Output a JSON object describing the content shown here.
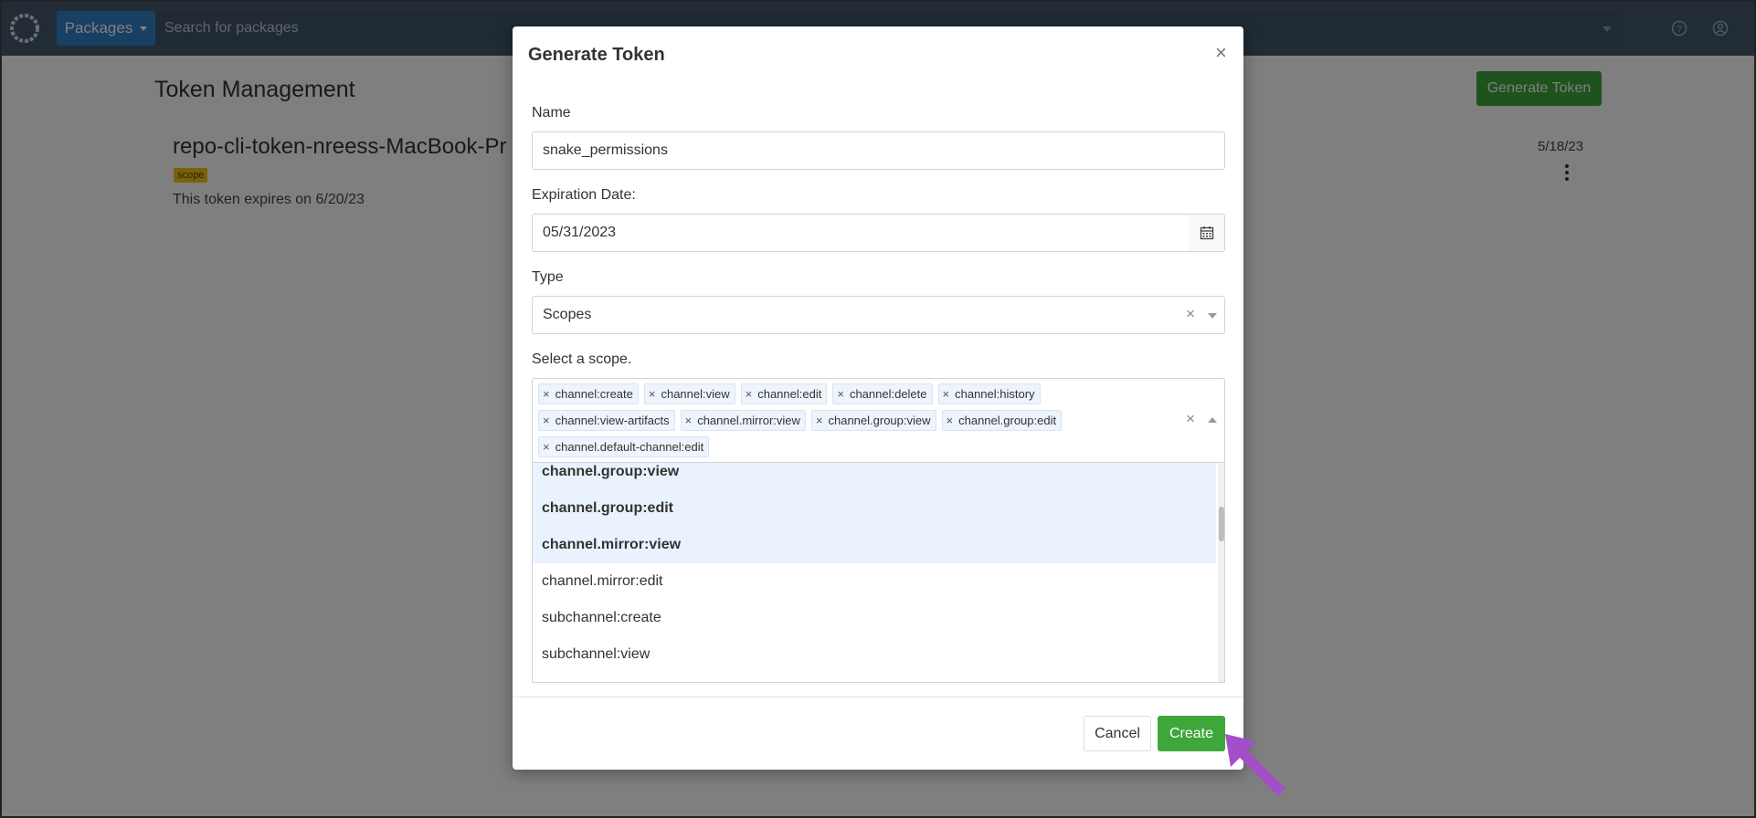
{
  "topbar": {
    "packages_label": "Packages",
    "search_placeholder": "Search for packages"
  },
  "page": {
    "title": "Token Management",
    "generate_button": "Generate Token",
    "token": {
      "name": "repo-cli-token-nreess-MacBook-Pr",
      "badge": "scope",
      "expiry": "This token expires on 6/20/23",
      "date": "5/18/23"
    }
  },
  "modal": {
    "title": "Generate Token",
    "name_label": "Name",
    "name_value": "snake_permissions",
    "expiration_label": "Expiration Date:",
    "expiration_value": "05/31/2023",
    "type_label": "Type",
    "type_value": "Scopes",
    "scope_label": "Select a scope.",
    "selected_scopes": [
      "channel:create",
      "channel:view",
      "channel:edit",
      "channel:delete",
      "channel:history",
      "channel:view-artifacts",
      "channel.mirror:view",
      "channel.group:view",
      "channel.group:edit",
      "channel.default-channel:edit"
    ],
    "options": [
      {
        "label": "channel.group:view",
        "selected": true
      },
      {
        "label": "channel.group:edit",
        "selected": true
      },
      {
        "label": "channel.mirror:view",
        "selected": true
      },
      {
        "label": "channel.mirror:edit",
        "selected": false
      },
      {
        "label": "subchannel:create",
        "selected": false
      },
      {
        "label": "subchannel:view",
        "selected": false
      }
    ],
    "cancel_label": "Cancel",
    "create_label": "Create"
  },
  "colors": {
    "topbar": "#43596d",
    "primary": "#2f80c8",
    "success": "#3fa63a",
    "badge": "#f0c419",
    "annotation_arrow": "#a24fc8"
  },
  "icons": [
    "logo-icon",
    "help-icon",
    "user-icon",
    "close-icon",
    "calendar-icon",
    "clear-icon",
    "chevron-down-icon",
    "chevron-up-icon",
    "kebab-icon"
  ]
}
